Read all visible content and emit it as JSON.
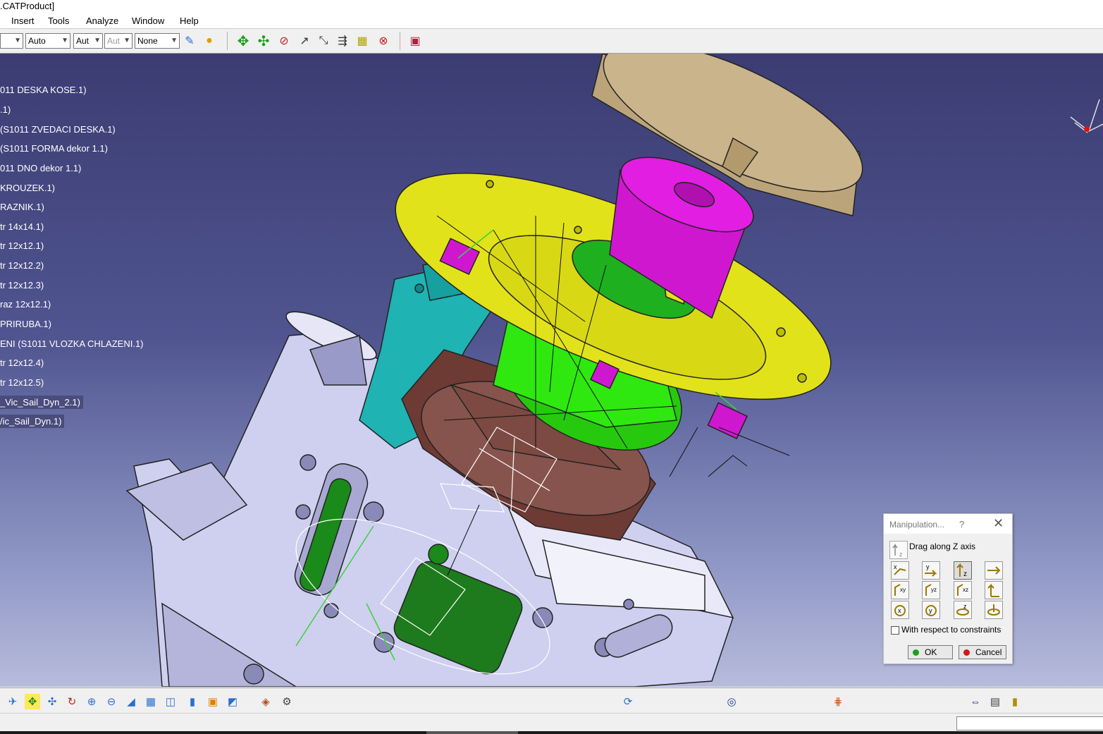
{
  "window": {
    "title": ".CATProduct]"
  },
  "menu": [
    {
      "id": "insert",
      "label": "Insert"
    },
    {
      "id": "tools",
      "label": "Tools"
    },
    {
      "id": "analyze",
      "label": "Analyze"
    },
    {
      "id": "window",
      "label": "Window"
    },
    {
      "id": "help",
      "label": "Help"
    }
  ],
  "toolbar": {
    "combo_1": "",
    "combo_2": "Auto",
    "combo_3": "Aut",
    "combo_4": "Aut",
    "combo_5": "None"
  },
  "tree": [
    "011 DESKA KOSE.1)",
    ".1)",
    "(S1011 ZVEDACI DESKA.1)",
    "(S1011 FORMA dekor 1.1)",
    "011 DNO dekor 1.1)",
    " KROUZEK.1)",
    "RAZNIK.1)",
    "tr 14x14.1)",
    "tr 12x12.1)",
    "tr 12x12.2)",
    "tr 12x12.3)",
    "raz 12x12.1)",
    " PRIRUBA.1)",
    "ENI (S1011 VLOZKA CHLAZENI.1)",
    "tr 12x12.4)",
    "tr 12x12.5)",
    "_Vic_Sail_Dyn_2.1)",
    "/ic_Sail_Dyn.1)"
  ],
  "dialog": {
    "title": "Manipulation...",
    "help": "?",
    "close": "✕",
    "current_mode": "Drag along Z axis",
    "grid_labels": [
      "x",
      "y",
      "z",
      "→",
      "xy",
      "yz",
      "xz",
      "↑",
      "x",
      "y",
      "z",
      "↻"
    ],
    "constraints_label": "With respect to constraints",
    "ok": "OK",
    "cancel": "Cancel"
  },
  "icons": {
    "top": [
      "move-icon",
      "snap-icon",
      "smart-move-icon",
      "explode-icon",
      "stop-manipulate-icon",
      "bill-of-material-icon",
      "measure-icon",
      "analysis-icon",
      "clash-icon",
      "catalog-icon"
    ],
    "bottom": [
      "fly-mode-icon",
      "fit-all-icon",
      "pan-icon",
      "rotate-icon",
      "zoom-in-icon",
      "zoom-out-icon",
      "normal-view-icon",
      "multi-view-icon",
      "iso-view-icon",
      "shading-icon",
      "hide-show-icon",
      "swap-space-icon",
      "render-icon",
      "settings-icon",
      "update-icon",
      "refresh-icon",
      "grid-icon",
      "measure-between-icon",
      "scan-icon",
      "lamp-icon"
    ]
  },
  "colors": {
    "viewport_top": "#3b3c72",
    "viewport_bottom": "#b7bcdc",
    "yellow_part": "#e2e21a",
    "magenta_part": "#e11ee1",
    "cyan_part": "#1fb3b3",
    "green_part": "#2ee80f",
    "brown_part": "#6e3a34",
    "tan_part": "#c9b48c",
    "lavender_part": "#cfcff0"
  }
}
